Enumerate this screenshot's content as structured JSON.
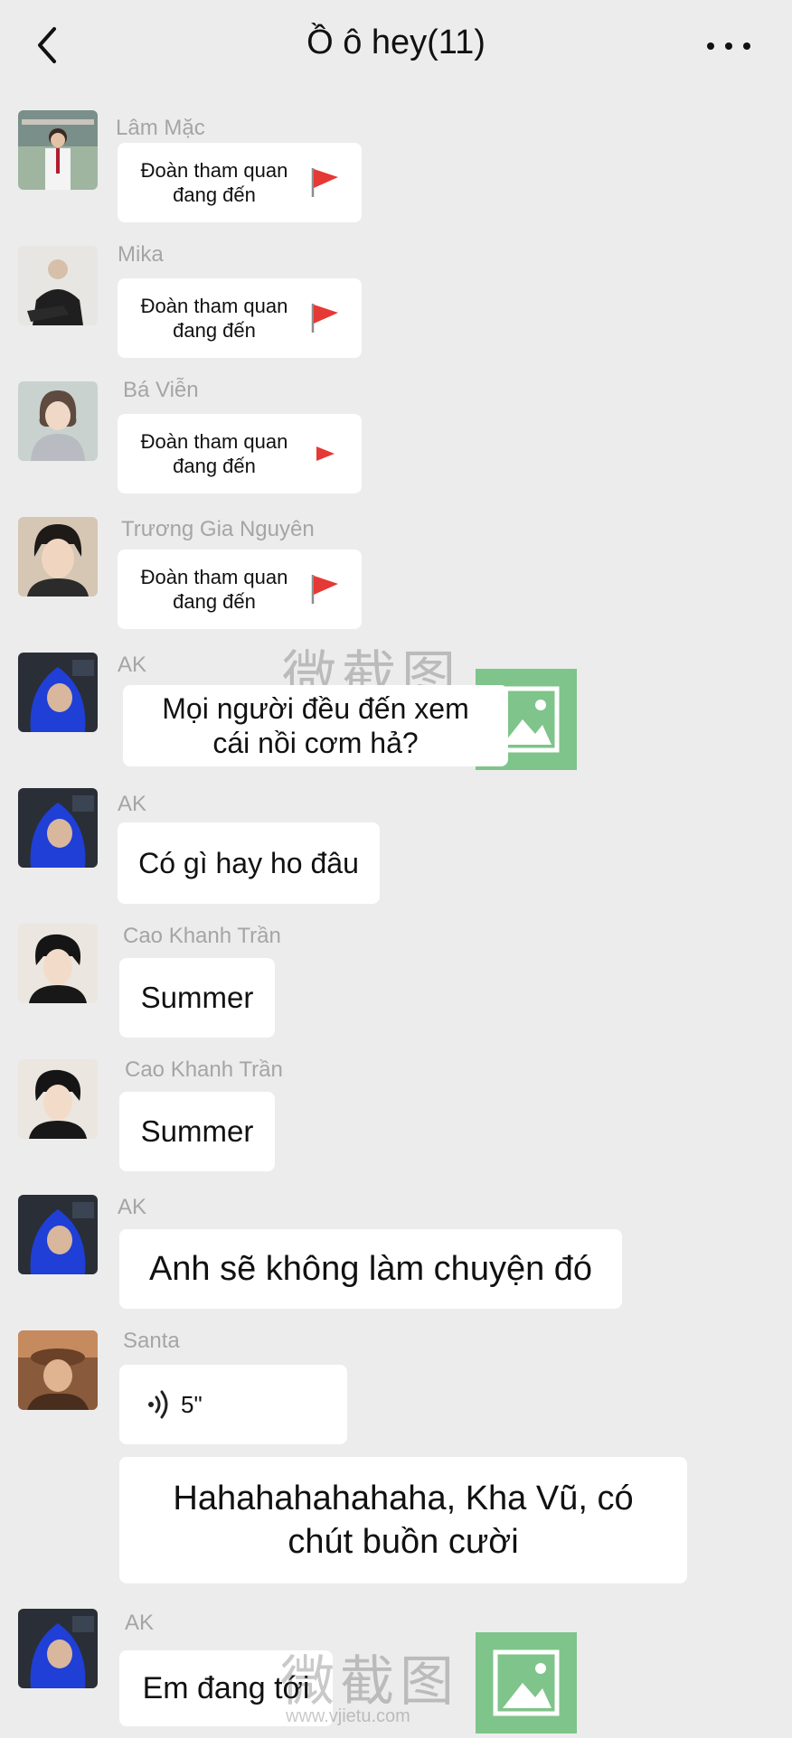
{
  "header": {
    "title": "Ồ ô hey(11)"
  },
  "colors": {
    "background": "#ececec",
    "bubble": "#ffffff",
    "sender_name": "#a5a5a5",
    "flag": "#e53935",
    "watermark_logo": "#7fc48a"
  },
  "messages": [
    {
      "sender": "Lâm Mặc",
      "type": "tour",
      "text": "Đoàn tham quan đang đến",
      "icon": "red-flag-icon"
    },
    {
      "sender": "Mika",
      "type": "tour",
      "text": "Đoàn tham quan đang đến",
      "icon": "red-flag-icon"
    },
    {
      "sender": "Bá Viễn",
      "type": "tour",
      "text": "Đoàn tham quan đang đến",
      "icon": "red-flag-icon"
    },
    {
      "sender": "Trương Gia Nguyên",
      "type": "tour",
      "text": "Đoàn tham quan đang đến",
      "icon": "red-flag-icon"
    },
    {
      "sender": "AK",
      "type": "text",
      "text": "Mọi người đều đến xem cái nồi cơm hả?"
    },
    {
      "sender": "AK",
      "type": "text",
      "text": "Có gì hay ho đâu"
    },
    {
      "sender": "Cao Khanh Trần",
      "type": "text",
      "text": "Summer"
    },
    {
      "sender": "Cao Khanh Trần",
      "type": "text",
      "text": "Summer"
    },
    {
      "sender": "AK",
      "type": "text",
      "text": "Anh sẽ không làm chuyện đó"
    },
    {
      "sender": "Santa",
      "type": "voice",
      "duration": "5\"",
      "icon": "voice-wave-icon"
    },
    {
      "sender": "",
      "type": "text",
      "text": "Hahahahahahaha, Kha Vũ, có chút buồn cười"
    },
    {
      "sender": "AK",
      "type": "text",
      "text": "Em đang tới"
    }
  ],
  "watermark": {
    "chinese": "微截图",
    "url": "www.vjietu.com"
  }
}
